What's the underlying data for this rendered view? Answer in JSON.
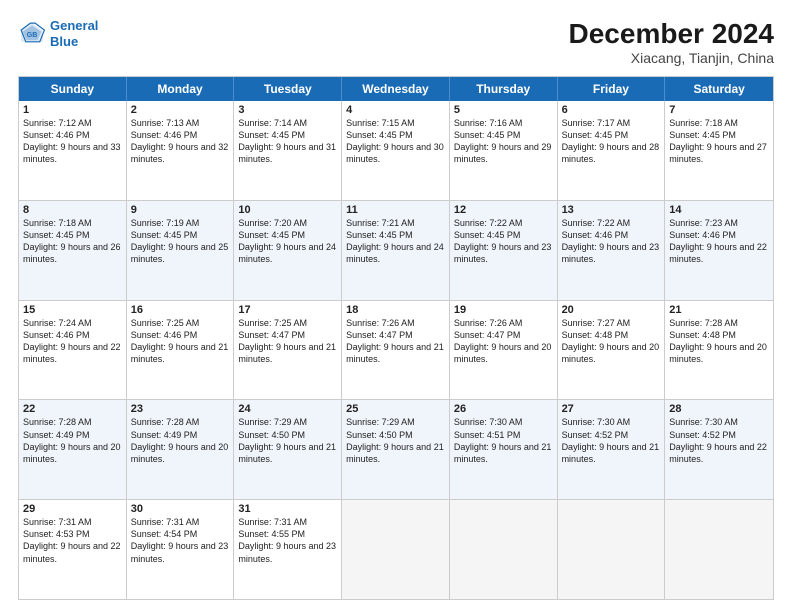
{
  "header": {
    "logo_line1": "General",
    "logo_line2": "Blue",
    "main_title": "December 2024",
    "subtitle": "Xiacang, Tianjin, China"
  },
  "days_of_week": [
    "Sunday",
    "Monday",
    "Tuesday",
    "Wednesday",
    "Thursday",
    "Friday",
    "Saturday"
  ],
  "weeks": [
    [
      {
        "day": "1",
        "sunrise": "Sunrise: 7:12 AM",
        "sunset": "Sunset: 4:46 PM",
        "daylight": "Daylight: 9 hours and 33 minutes."
      },
      {
        "day": "2",
        "sunrise": "Sunrise: 7:13 AM",
        "sunset": "Sunset: 4:46 PM",
        "daylight": "Daylight: 9 hours and 32 minutes."
      },
      {
        "day": "3",
        "sunrise": "Sunrise: 7:14 AM",
        "sunset": "Sunset: 4:45 PM",
        "daylight": "Daylight: 9 hours and 31 minutes."
      },
      {
        "day": "4",
        "sunrise": "Sunrise: 7:15 AM",
        "sunset": "Sunset: 4:45 PM",
        "daylight": "Daylight: 9 hours and 30 minutes."
      },
      {
        "day": "5",
        "sunrise": "Sunrise: 7:16 AM",
        "sunset": "Sunset: 4:45 PM",
        "daylight": "Daylight: 9 hours and 29 minutes."
      },
      {
        "day": "6",
        "sunrise": "Sunrise: 7:17 AM",
        "sunset": "Sunset: 4:45 PM",
        "daylight": "Daylight: 9 hours and 28 minutes."
      },
      {
        "day": "7",
        "sunrise": "Sunrise: 7:18 AM",
        "sunset": "Sunset: 4:45 PM",
        "daylight": "Daylight: 9 hours and 27 minutes."
      }
    ],
    [
      {
        "day": "8",
        "sunrise": "Sunrise: 7:18 AM",
        "sunset": "Sunset: 4:45 PM",
        "daylight": "Daylight: 9 hours and 26 minutes."
      },
      {
        "day": "9",
        "sunrise": "Sunrise: 7:19 AM",
        "sunset": "Sunset: 4:45 PM",
        "daylight": "Daylight: 9 hours and 25 minutes."
      },
      {
        "day": "10",
        "sunrise": "Sunrise: 7:20 AM",
        "sunset": "Sunset: 4:45 PM",
        "daylight": "Daylight: 9 hours and 24 minutes."
      },
      {
        "day": "11",
        "sunrise": "Sunrise: 7:21 AM",
        "sunset": "Sunset: 4:45 PM",
        "daylight": "Daylight: 9 hours and 24 minutes."
      },
      {
        "day": "12",
        "sunrise": "Sunrise: 7:22 AM",
        "sunset": "Sunset: 4:45 PM",
        "daylight": "Daylight: 9 hours and 23 minutes."
      },
      {
        "day": "13",
        "sunrise": "Sunrise: 7:22 AM",
        "sunset": "Sunset: 4:46 PM",
        "daylight": "Daylight: 9 hours and 23 minutes."
      },
      {
        "day": "14",
        "sunrise": "Sunrise: 7:23 AM",
        "sunset": "Sunset: 4:46 PM",
        "daylight": "Daylight: 9 hours and 22 minutes."
      }
    ],
    [
      {
        "day": "15",
        "sunrise": "Sunrise: 7:24 AM",
        "sunset": "Sunset: 4:46 PM",
        "daylight": "Daylight: 9 hours and 22 minutes."
      },
      {
        "day": "16",
        "sunrise": "Sunrise: 7:25 AM",
        "sunset": "Sunset: 4:46 PM",
        "daylight": "Daylight: 9 hours and 21 minutes."
      },
      {
        "day": "17",
        "sunrise": "Sunrise: 7:25 AM",
        "sunset": "Sunset: 4:47 PM",
        "daylight": "Daylight: 9 hours and 21 minutes."
      },
      {
        "day": "18",
        "sunrise": "Sunrise: 7:26 AM",
        "sunset": "Sunset: 4:47 PM",
        "daylight": "Daylight: 9 hours and 21 minutes."
      },
      {
        "day": "19",
        "sunrise": "Sunrise: 7:26 AM",
        "sunset": "Sunset: 4:47 PM",
        "daylight": "Daylight: 9 hours and 20 minutes."
      },
      {
        "day": "20",
        "sunrise": "Sunrise: 7:27 AM",
        "sunset": "Sunset: 4:48 PM",
        "daylight": "Daylight: 9 hours and 20 minutes."
      },
      {
        "day": "21",
        "sunrise": "Sunrise: 7:28 AM",
        "sunset": "Sunset: 4:48 PM",
        "daylight": "Daylight: 9 hours and 20 minutes."
      }
    ],
    [
      {
        "day": "22",
        "sunrise": "Sunrise: 7:28 AM",
        "sunset": "Sunset: 4:49 PM",
        "daylight": "Daylight: 9 hours and 20 minutes."
      },
      {
        "day": "23",
        "sunrise": "Sunrise: 7:28 AM",
        "sunset": "Sunset: 4:49 PM",
        "daylight": "Daylight: 9 hours and 20 minutes."
      },
      {
        "day": "24",
        "sunrise": "Sunrise: 7:29 AM",
        "sunset": "Sunset: 4:50 PM",
        "daylight": "Daylight: 9 hours and 21 minutes."
      },
      {
        "day": "25",
        "sunrise": "Sunrise: 7:29 AM",
        "sunset": "Sunset: 4:50 PM",
        "daylight": "Daylight: 9 hours and 21 minutes."
      },
      {
        "day": "26",
        "sunrise": "Sunrise: 7:30 AM",
        "sunset": "Sunset: 4:51 PM",
        "daylight": "Daylight: 9 hours and 21 minutes."
      },
      {
        "day": "27",
        "sunrise": "Sunrise: 7:30 AM",
        "sunset": "Sunset: 4:52 PM",
        "daylight": "Daylight: 9 hours and 21 minutes."
      },
      {
        "day": "28",
        "sunrise": "Sunrise: 7:30 AM",
        "sunset": "Sunset: 4:52 PM",
        "daylight": "Daylight: 9 hours and 22 minutes."
      }
    ],
    [
      {
        "day": "29",
        "sunrise": "Sunrise: 7:31 AM",
        "sunset": "Sunset: 4:53 PM",
        "daylight": "Daylight: 9 hours and 22 minutes."
      },
      {
        "day": "30",
        "sunrise": "Sunrise: 7:31 AM",
        "sunset": "Sunset: 4:54 PM",
        "daylight": "Daylight: 9 hours and 23 minutes."
      },
      {
        "day": "31",
        "sunrise": "Sunrise: 7:31 AM",
        "sunset": "Sunset: 4:55 PM",
        "daylight": "Daylight: 9 hours and 23 minutes."
      },
      null,
      null,
      null,
      null
    ]
  ]
}
